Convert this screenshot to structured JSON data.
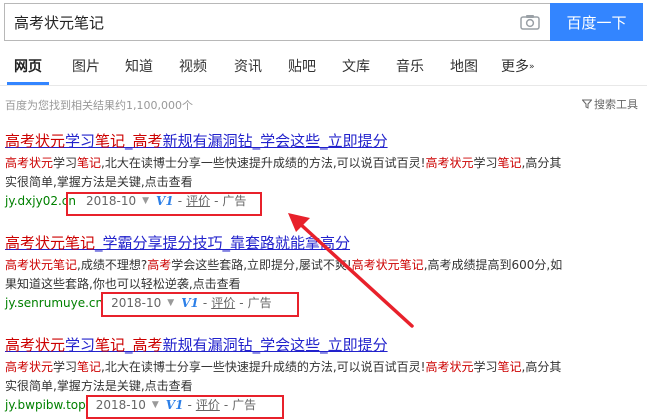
{
  "search": {
    "query": "高考状元笔记",
    "button_label": "百度一下"
  },
  "tabs": [
    {
      "label": "网页"
    },
    {
      "label": "图片"
    },
    {
      "label": "知道"
    },
    {
      "label": "视频"
    },
    {
      "label": "资讯"
    },
    {
      "label": "贴吧"
    },
    {
      "label": "文库"
    },
    {
      "label": "音乐"
    },
    {
      "label": "地图"
    },
    {
      "label": "更多"
    }
  ],
  "tabs_more_arrow": "»",
  "result_count": "百度为您找到相关结果约1,100,000个",
  "search_tools": "搜索工具",
  "results": [
    {
      "title_parts": [
        "高考状元",
        "学习",
        "笔记",
        "_",
        "高考",
        "新规有漏洞钻_学会这些_立即提分"
      ],
      "desc_parts": [
        "高考状元",
        "学习",
        "笔记",
        ",北大在读博士分享一些快速提升成绩的方法,可以说百试百灵!",
        "高考状元",
        "学习",
        "笔记",
        ",高分其实很简单,掌握方法是关键,点击查看"
      ],
      "url": "jy.dxjy02.cn",
      "date": "2018-10",
      "caret": "▼",
      "v_badge": "V1",
      "sep1": "-",
      "eval": "评价",
      "sep2": "-",
      "ad": "广告"
    },
    {
      "title_parts": [
        "高考状元笔记",
        "_学霸分享提分技巧_靠套路就能拿高分"
      ],
      "desc_parts": [
        "高考状元笔记",
        ",成绩不理想?",
        "高考",
        "学会这些套路,立即提分,屡试不爽!",
        "高考状元笔记",
        ",高考成绩提高到600分,如果知道这些套路,你也可以轻松逆袭,点击查看"
      ],
      "url": "jy.senrumuye.cn",
      "date": "2018-10",
      "caret": "▼",
      "v_badge": "V1",
      "sep1": "-",
      "eval": "评价",
      "sep2": "-",
      "ad": "广告"
    },
    {
      "title_parts": [
        "高考状元",
        "学习",
        "笔记",
        "_",
        "高考",
        "新规有漏洞钻_学会这些_立即提分"
      ],
      "desc_parts": [
        "高考状元",
        "学习",
        "笔记",
        ",北大在读博士分享一些快速提升成绩的方法,可以说百试百灵!",
        "高考状元",
        "学习",
        "笔记",
        ",高分其实很简单,掌握方法是关键,点击查看"
      ],
      "url": "jy.bwpibw.top",
      "date": "2018-10",
      "caret": "▼",
      "v_badge": "V1",
      "sep1": "-",
      "eval": "评价",
      "sep2": "-",
      "ad": "广告"
    }
  ],
  "colors": {
    "accent": "#3385ff",
    "title_link": "#2222cc",
    "highlight": "#cc0000",
    "url_green": "#008000",
    "annotation_red": "#e8212b"
  },
  "icons": {
    "camera": "camera-icon",
    "filter": "filter-icon"
  }
}
